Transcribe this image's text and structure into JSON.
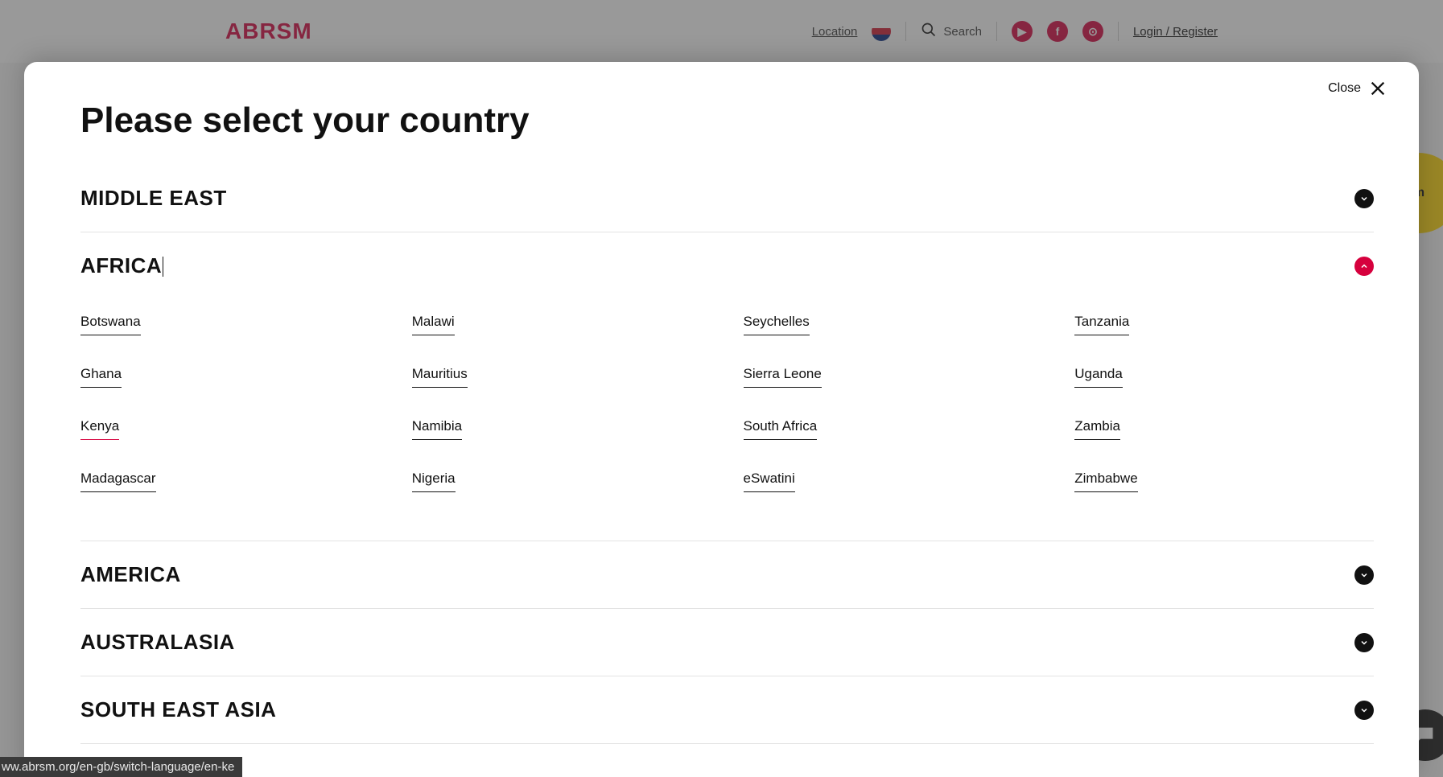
{
  "header": {
    "logo": "ABRSM",
    "location_label": "Location",
    "search_label": "Search",
    "login_label": "Login / Register",
    "social": {
      "youtube": "▶",
      "facebook": "f",
      "instagram": "⊙"
    },
    "yellow_badge": "m"
  },
  "modal": {
    "close_label": "Close",
    "title": "Please select your country",
    "regions": [
      {
        "name": "MIDDLE EAST",
        "expanded": false
      },
      {
        "name": "AFRICA",
        "expanded": true,
        "countries_cols": [
          [
            "Botswana",
            "Ghana",
            "Kenya",
            "Madagascar"
          ],
          [
            "Malawi",
            "Mauritius",
            "Namibia",
            "Nigeria"
          ],
          [
            "Seychelles",
            "Sierra Leone",
            "South Africa",
            "eSwatini"
          ],
          [
            "Tanzania",
            "Uganda",
            "Zambia",
            "Zimbabwe"
          ]
        ],
        "hovered": "Kenya"
      },
      {
        "name": "AMERICA",
        "expanded": false
      },
      {
        "name": "AUSTRALASIA",
        "expanded": false
      },
      {
        "name": "SOUTH EAST ASIA",
        "expanded": false
      }
    ]
  },
  "status_url": "ww.abrsm.org/en-gb/switch-language/en-ke"
}
